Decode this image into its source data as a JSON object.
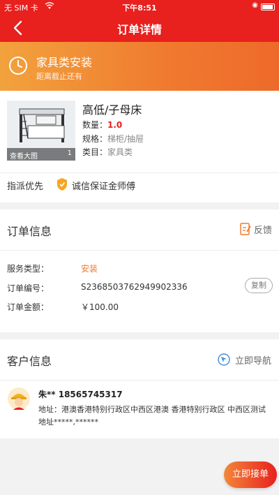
{
  "status_bar": {
    "carrier": "无 SIM 卡",
    "time": "下午8:51"
  },
  "nav": {
    "title": "订单详情"
  },
  "banner": {
    "service_name": "家具类安装",
    "deadline_text": "距离截止还有"
  },
  "product": {
    "name": "高低/子母床",
    "view_large": "查看大图",
    "image_count": "1",
    "quantity_label": "数量：",
    "quantity_value": "1.0",
    "spec_label": "规格：",
    "spec_value": "梯柜/抽屉",
    "category_label": "类目：",
    "category_value": "家具类",
    "dispatch_label": "指派优先",
    "credit_label": "诚信保证金师傅"
  },
  "order_info": {
    "title": "订单信息",
    "feedback_label": "反馈",
    "service_type_label": "服务类型：",
    "service_type_value": "安装",
    "order_no_label": "订单编号：",
    "order_no_value": "S2368503762949902336",
    "copy_label": "复制",
    "amount_label": "订单金额：",
    "amount_value": "￥100.00"
  },
  "customer_info": {
    "title": "客户信息",
    "navigate_label": "立即导航",
    "name_phone": "朱** 18565745317",
    "address": "地址：港澳香港特别行政区中西区港澳 香港特别行政区 中西区测试地址*****,******"
  },
  "actions": {
    "accept_label": "立即接单"
  },
  "colors": {
    "primary_red": "#e8201e",
    "banner_orange": "#f07a2f",
    "accent_orange": "#ef7a2e"
  },
  "icons": [
    "back-icon",
    "wifi-icon",
    "location-icon",
    "battery-icon",
    "clock-icon",
    "shield-icon",
    "feedback-icon",
    "navigation-icon",
    "worker-avatar"
  ]
}
